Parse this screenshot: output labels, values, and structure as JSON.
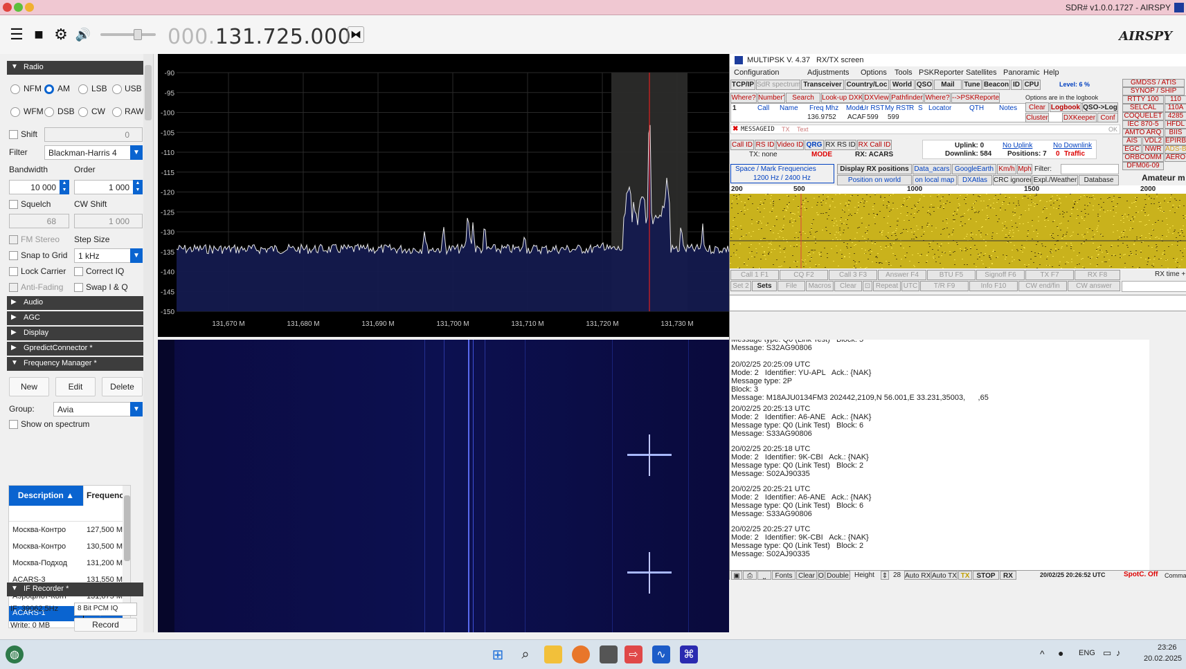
{
  "window": {
    "title": "SDR# v1.0.0.1727 - AIRSPY"
  },
  "toolbar": {
    "freq_dim": "000.",
    "freq_main": "131.725.000",
    "logo": "AIRSPY"
  },
  "radio": {
    "section": "Radio",
    "modes": [
      "NFM",
      "AM",
      "LSB",
      "USB",
      "WFM",
      "DSB",
      "CW",
      "RAW"
    ],
    "selected_mode": "AM",
    "shift_label": "Shift",
    "shift_value": "0",
    "filter_label": "Filter",
    "filter_value": "Blackman-Harris 4",
    "bandwidth_label": "Bandwidth",
    "bandwidth_value": "10 000",
    "order_label": "Order",
    "order_value": "1 000",
    "squelch_label": "Squelch",
    "squelch_value": "68",
    "cwshift_label": "CW Shift",
    "cwshift_value": "1 000",
    "fmstereo_label": "FM Stereo",
    "stepsize_label": "Step Size",
    "snap_label": "Snap to Grid",
    "step_value": "1 kHz",
    "lockcarrier_label": "Lock Carrier",
    "correctiq_label": "Correct IQ",
    "antifading_label": "Anti-Fading",
    "swapiq_label": "Swap I & Q"
  },
  "sections": [
    "Audio",
    "AGC",
    "Display",
    "GpredictConnector *",
    "Frequency Manager *",
    "IF Recorder *"
  ],
  "fm": {
    "new": "New",
    "edit": "Edit",
    "delete": "Delete",
    "group_label": "Group:",
    "group_value": "Avia",
    "show_label": "Show on spectrum",
    "col_desc": "Description",
    "col_freq": "Frequency",
    "rows": [
      {
        "desc": "Москва-Контро",
        "freq": "127,500 M"
      },
      {
        "desc": "Москва-Контро",
        "freq": "130,500 M"
      },
      {
        "desc": "Москва-Подход",
        "freq": "131,200 M"
      },
      {
        "desc": "ACARS-3",
        "freq": "131,550 M"
      },
      {
        "desc": "Аэрофлот-Конт",
        "freq": "131,675 M"
      },
      {
        "desc": "ACARS-1",
        "freq": "131,725 M"
      }
    ]
  },
  "ifrec": {
    "if": "IF: 39062,5Hz",
    "format": "8 Bit PCM IQ",
    "write": "Write:  0 MB",
    "record": "Record"
  },
  "spectrum": {
    "y_ticks": [
      "-90",
      "-95",
      "-100",
      "-105",
      "-110",
      "-115",
      "-120",
      "-125",
      "-130",
      "-135",
      "-140",
      "-145",
      "-150"
    ],
    "x_ticks": [
      "131,670 M",
      "131,680 M",
      "131,690 M",
      "131,700 M",
      "131,710 M",
      "131,720 M",
      "131,730 M"
    ]
  },
  "mpsk": {
    "title": "MULTIPSK V. 4.37",
    "subtitle": "RX/TX screen",
    "menu": [
      "Configuration",
      "Adjustments",
      "Options",
      "Tools",
      "PSKReporter",
      "Satellites",
      "Panoramic",
      "Help"
    ],
    "row1": [
      "TCP/IP",
      "SdR spectrum",
      "Transceiver",
      "Country/Loc",
      "World",
      "QSO",
      "Mail",
      "Tune",
      "Beacon",
      "ID",
      "CPU"
    ],
    "level": "Level:  6 %",
    "right_modes": [
      "GMDSS / ATIS",
      "SYNOP / SHIP",
      "RTTY 100",
      "110",
      "SELCAL",
      "110A",
      "COQUELET",
      "4285",
      "IEC 870-5",
      "HFDL",
      "AMTO ARQ",
      "BIIS",
      "AIS",
      "VDL2",
      "EPIRB",
      "EGC",
      "NWR",
      "ADS-B",
      "ORBCOMM",
      "AERO",
      "DFM06-09",
      "Amateur m"
    ],
    "row2": [
      "Where?",
      "Number?",
      "Search",
      "Look-up DXK",
      "DXView",
      "Pathfinder",
      "Where?",
      "-->PSKReporter"
    ],
    "options_note": "Options are in the logbook",
    "log_headers": [
      "Call",
      "Name",
      "Freq Mhz",
      "Mode",
      "Ur RST",
      "My RST",
      "R",
      "S",
      "Locator",
      "QTH",
      "Notes"
    ],
    "log_num": "1",
    "log_freq": "136.9752",
    "log_mode": "ACAF",
    "log_urrst": "599",
    "log_myrst": "599",
    "clear": "Clear",
    "logbook": "Logbook",
    "qsolog": "QSO->Log",
    "cluster": "Cluster",
    "dxkeeper": "DXKeeper",
    "conf": "Conf",
    "msgid": "MESSAGEID",
    "tx": "TX",
    "text": "Text",
    "ok": "OK",
    "callid": [
      "Call ID",
      "RS ID",
      "Video ID",
      "QRG",
      "RX RS ID",
      "RX Call ID"
    ],
    "txnone": "TX: none",
    "mode": "MODE",
    "rxacars": "RX: ACARS",
    "uplink": "Uplink: 0",
    "downlink": "Downlink: 584",
    "noup": "No Uplink",
    "nodown": "No Downlink",
    "positions": "Positions: 7",
    "zero": "0",
    "traffic": "Traffic",
    "sm_title": "Space / Mark Frequencies",
    "sm_value": "1200 Hz / 2400 Hz",
    "disp_rx": "Display RX positions",
    "data_acars": "Data_acars",
    "google": "GoogleEarth",
    "kmh": "Km/h",
    "mph": "Mph",
    "filter": "Filter:",
    "pos_world": "Position on world",
    "on_local": "on local map",
    "dxatlas": "DXAtlas",
    "crc": "CRC ignored",
    "expl": "Expl./Weather",
    "database": "Database",
    "scale": [
      "200",
      "500",
      "1000",
      "1500",
      "2000"
    ],
    "fkeys1": [
      "Call 1  F1",
      "CQ  F2",
      "Call 3  F3",
      "Answer  F4",
      "BTU  F5",
      "Signoff F6",
      "TX  F7",
      "RX  F8"
    ],
    "fkeys2": [
      "Set 2",
      "Sets",
      "File",
      "Macros",
      "Clear",
      "",
      "Repeat",
      "UTC",
      "T/R  F9",
      "Info  F10",
      "CW end/fin",
      "CW answer"
    ],
    "rxtime": "RX time +",
    "messages": [
      "Message type: Q0 (Link Test)   Block: 5\nMessage: S32AG90806",
      "20/02/25 20:25:09 UTC\nMode: 2   Identifier: YU-APL   Ack.: {NAK}\nMessage type: 2P\nBlock: 3\nMessage: M18AJU0134FM3 202442,2109,N 56.001,E 33.231,35003,      ,65",
      "20/02/25 20:25:13 UTC\nMode: 2   Identifier: A6-ANE   Ack.: {NAK}\nMessage type: Q0 (Link Test)   Block: 6\nMessage: S33AG90806",
      "20/02/25 20:25:18 UTC\nMode: 2   Identifier: 9K-CBI   Ack.: {NAK}\nMessage type: Q0 (Link Test)   Block: 2\nMessage: S02AJ90335",
      "20/02/25 20:25:21 UTC\nMode: 2   Identifier: A6-ANE   Ack.: {NAK}\nMessage type: Q0 (Link Test)   Block: 6\nMessage: S33AG90806",
      "20/02/25 20:25:27 UTC\nMode: 2   Identifier: 9K-CBI   Ack.: {NAK}\nMessage type: Q0 (Link Test)   Block: 2\nMessage: S02AJ90335"
    ],
    "bottom": [
      "Fonts",
      "Clear",
      "Ol",
      "Double",
      "Height",
      "28",
      "Auto RX",
      "Auto TX",
      "TX",
      "STOP",
      "RX"
    ],
    "bottom_time": "20/02/25 20:26:52 UTC",
    "spotc": "SpotC. Off",
    "comma": "Comma"
  },
  "taskbar": {
    "lang": "ENG",
    "time": "23:26",
    "date": "20.02.2025"
  }
}
